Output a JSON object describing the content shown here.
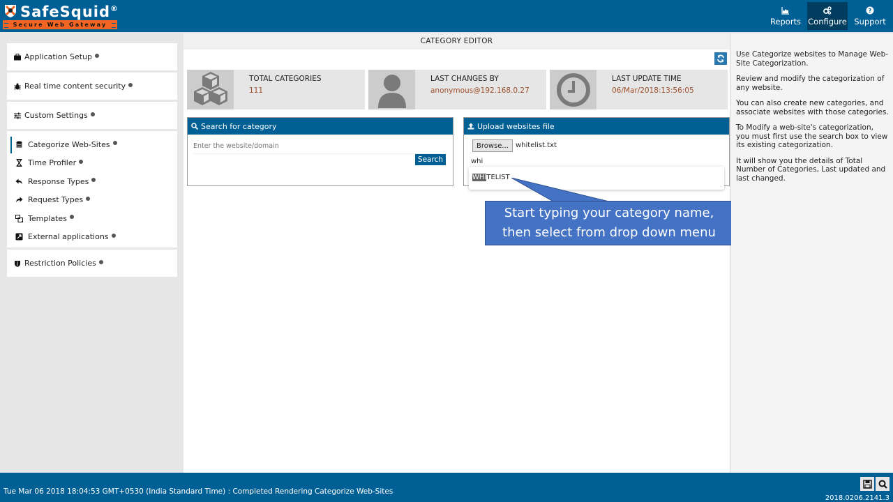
{
  "header": {
    "logo_name": "SafeSquid",
    "logo_reg": "®",
    "logo_tagline": "Secure Web Gateway",
    "nav": [
      {
        "label": "Reports",
        "icon": "area-chart-icon",
        "active": false
      },
      {
        "label": "Configure",
        "icon": "cogs-icon",
        "active": true
      },
      {
        "label": "Support",
        "icon": "question-circle-icon",
        "active": false
      }
    ]
  },
  "sidebar": {
    "groups": [
      {
        "label": "Application Setup",
        "icon": "briefcase-icon"
      },
      {
        "label": "Real time content security",
        "icon": "bug-icon"
      },
      {
        "label": "Custom Settings",
        "icon": "sliders-icon"
      },
      {
        "label": "Restriction Policies",
        "icon": "shield-icon"
      }
    ],
    "custom_items": [
      {
        "label": "Categorize Web-Sites",
        "icon": "database-icon",
        "active": true
      },
      {
        "label": "Time Profiler",
        "icon": "hourglass-icon"
      },
      {
        "label": "Response Types",
        "icon": "reply-icon"
      },
      {
        "label": "Request Types",
        "icon": "share-icon"
      },
      {
        "label": "Templates",
        "icon": "object-group-icon"
      },
      {
        "label": "External applications",
        "icon": "external-link-icon"
      }
    ]
  },
  "main": {
    "title": "CATEGORY EDITOR",
    "stats": [
      {
        "label": "TOTAL CATEGORIES",
        "value": "111",
        "icon": "cubes-icon"
      },
      {
        "label": "LAST CHANGES BY",
        "value": "anonymous@192.168.0.27",
        "icon": "user-icon"
      },
      {
        "label": "LAST UPDATE TIME",
        "value": "06/Mar/2018:13:56:05",
        "icon": "clock-icon"
      }
    ],
    "search_panel": {
      "title": "Search for category",
      "placeholder": "Enter the website/domain",
      "button": "Search"
    },
    "upload_panel": {
      "title": "Upload websites file",
      "browse_label": "Browse...",
      "file_name": "whitelist.txt",
      "category_input": "whi"
    },
    "autocomplete": {
      "match": "WHI",
      "rest": "TELIST"
    },
    "callout": {
      "line1": "Start typing your category name,",
      "line2": "then select from drop down menu",
      "color": "#4472c4"
    }
  },
  "help": {
    "paragraphs": [
      "Use Categorize websites to Manage Web-Site Categorization.",
      "Review and modify the categorization of any website.",
      "You can also create new categories, and associate websites with those categories.",
      "To Modify a web-site's categorization, you must first use the search box to view its existing categorization.",
      "It will show you the details of Total Number of Categories, Last updated and last changed."
    ]
  },
  "footer": {
    "status": "Tue Mar 06 2018 18:04:53 GMT+0530 (India Standard Time) : Completed Rendering Categorize Web-Sites",
    "version": "2018.0206.2141.3"
  },
  "colors": {
    "brand": "#005f94",
    "brand_dark": "#003d5e",
    "accent_orange": "#f26522",
    "stat_value": "#a0522d"
  }
}
